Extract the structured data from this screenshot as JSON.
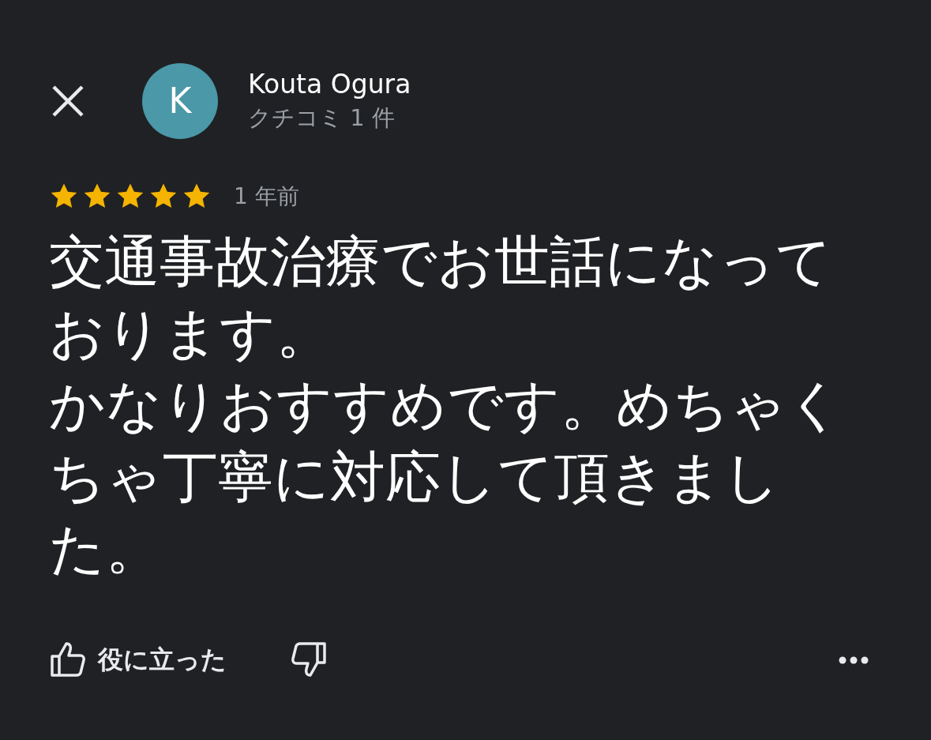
{
  "reviewer": {
    "name": "Kouta Ogura",
    "initial": "K",
    "review_count": "クチコミ 1 件"
  },
  "review": {
    "stars": 5,
    "time": "1 年前",
    "paragraphs": [
      "交通事故治療でお世話になっております。",
      "かなりおすすめです。めちゃくちゃ丁寧に対応して頂きました。"
    ]
  },
  "actions": {
    "helpful_label": "役に立った"
  }
}
